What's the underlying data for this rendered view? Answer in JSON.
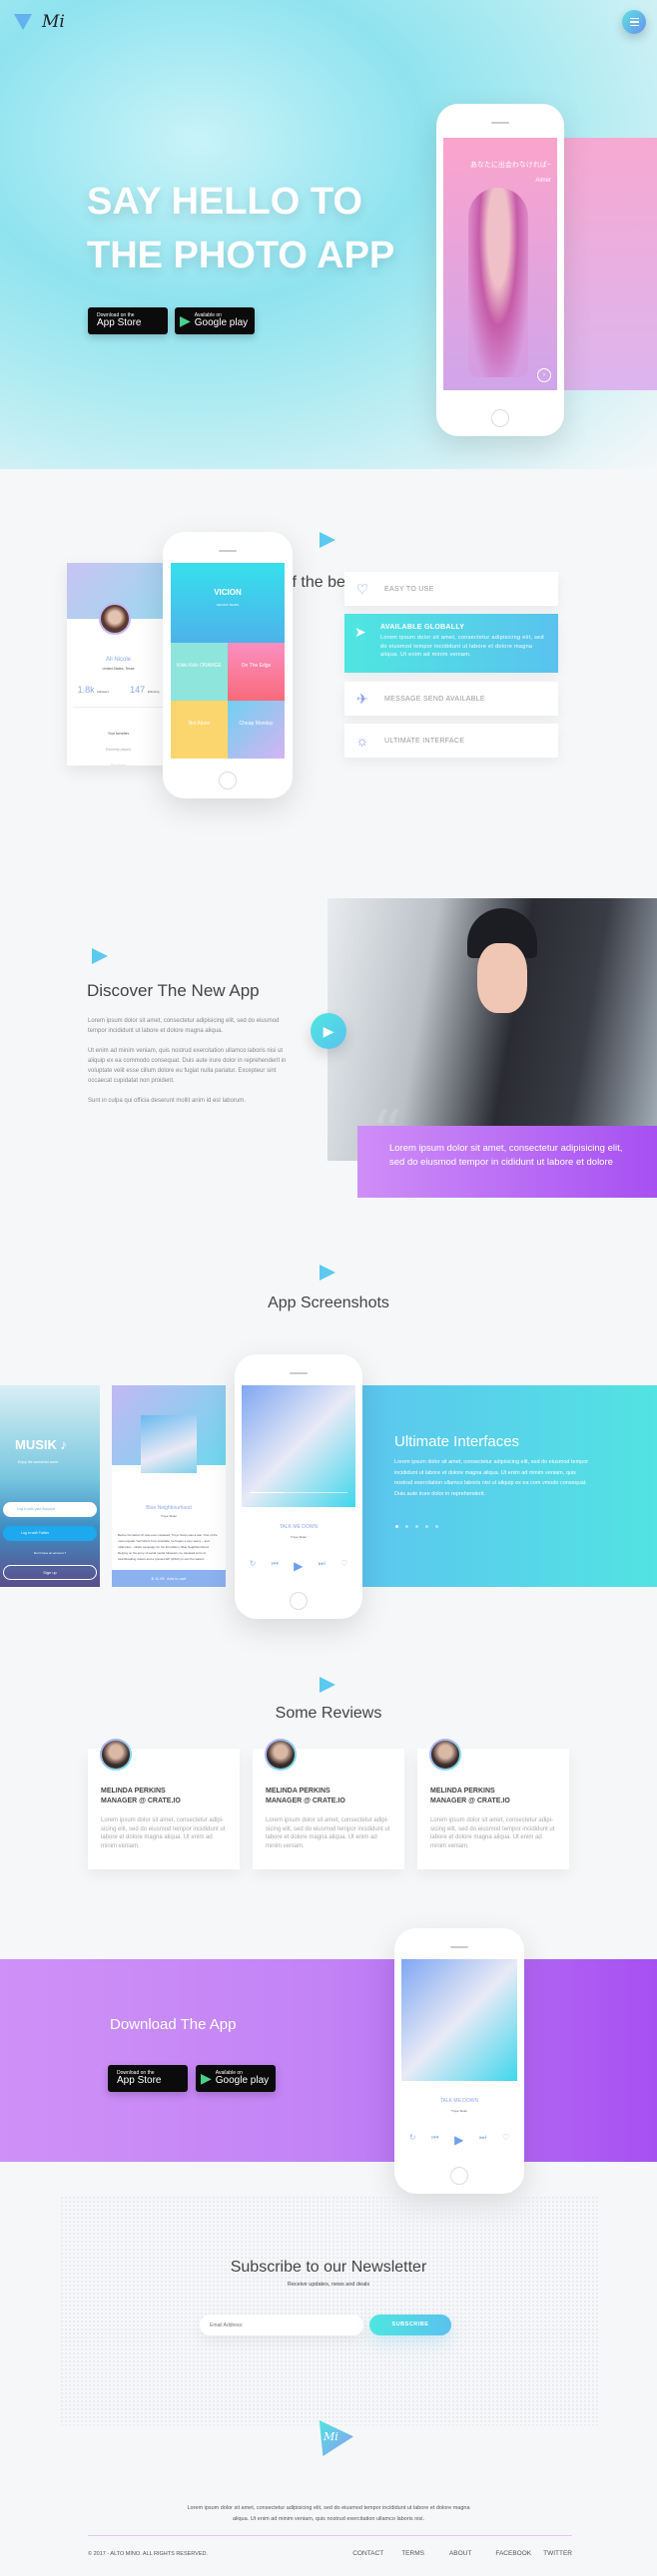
{
  "brand": {
    "logo_text": "Mi"
  },
  "hero": {
    "headline_line1": "SAY HELLO TO",
    "headline_line2": "THE PHOTO APP",
    "app_store": {
      "small": "Download on the",
      "big": "App Store"
    },
    "google_play": {
      "small": "Available on",
      "big": "Google play"
    },
    "phone": {
      "lyric": "あなたに出会わなければ~",
      "artist": "Aimer"
    }
  },
  "features": {
    "title": "Some of the best features",
    "profile": {
      "name": "Ali Nicole",
      "location": "United States, Texas",
      "followers": "1.8k",
      "followers_label": "followers",
      "following": "147",
      "following_label": "following",
      "menu": [
        "Your favorites",
        "Recently played",
        "Purchase"
      ]
    },
    "phone": {
      "banner_title": "VICION",
      "banner_sub": "DEVIN'S TEARS",
      "tiles": [
        "Kikki Kids ORANGE",
        "On The Edge",
        "Not Alone",
        "Cheap Monday"
      ]
    },
    "items": [
      {
        "label": "EASY TO USE",
        "icon": "heart-icon"
      },
      {
        "label": "AVAILABLE GLOBALLY",
        "icon": "navigation-icon",
        "text": "Lorem ipsum dolor sit amet, consectetur adipisicing elit, sed do eiusmod tempor incididunt ut labore et dolore magna aliqua. Ut enim ad minim veniam."
      },
      {
        "label": "MESSAGE SEND AVAILABLE",
        "icon": "paper-plane-icon"
      },
      {
        "label": "ULTIMATE INTERFACE",
        "icon": "lightbulb-icon"
      }
    ]
  },
  "discover": {
    "title": "Discover The New App",
    "p1": "Lorem ipsum dolor sit amet, consectetur adipisicing elit, sed do eiusmod tempor incididunt ut labore et dolore magna aliqua.",
    "p2": "Ut enim ad minim veniam, quis nostrud exercitation ullamco laboris nisi ut aliquip ex ea commodo consequat. Duis aute irure dolor in reprehenderit in voluptate velit esse cillum dolore eu fugiat nulla pariatur. Excepteur sint occaecat cupidatat non proident.",
    "p3": "Sunt in culpa qui officia deserunt mollit anim id est laborum.",
    "quote": "Lorem ipsum dolor sit amet, consectetur adipisicing elit, sed do eiusmod tempor in cididunt ut labore et dolore"
  },
  "screenshots": {
    "title": "App Screenshots",
    "login": {
      "app": "MUSIK ♪",
      "tagline": "Enjoy the wonderful world",
      "login_account": "Log in with your Account",
      "login_twitter": "Log in with Twitter",
      "no_account": "Don't have an account ?",
      "signup": "Sign up"
    },
    "album": {
      "title": "Blue Neighbourhood",
      "artist": "Troye Sivan",
      "text": "Before his debut LP was even released, Troye Sivan was a star. One of the most popular YouTubers from Australia, he began a very savvy – and millennial – rollout campaign for his first album, Blue Neighbourhood. Relying on his army of social media followers, he released a trio of heartbreaking videos and a preview EP (WILD) to test the waters.",
      "price": "$ 11.99",
      "cart": "Add to cart"
    },
    "player": {
      "song": "TALK ME DOWN",
      "artist": "Troye Sivan",
      "time_start": "01:45",
      "time_end": "03:37",
      "progress": 0.35
    },
    "panel": {
      "title": "Ultimate Interfaces",
      "text": "Lorem ipsum dolor sit amet, consectetur adipisicing elit, sed do eiusmod tempor incididunt ut labore et dolore magna aliqua. Ut enim ad minim veniam, quis nostrud exercitation ullamco laboris nisi ut aliquip ex ea com vmodo consequat. Duis aute irure dolor in reprehenderit.",
      "slides": 5,
      "active_slide": 1
    }
  },
  "reviews": {
    "title": "Some Reviews",
    "items": [
      {
        "name": "MELINDA PERKINS",
        "role": "MANAGER @ CRATE.IO",
        "text": "Lorem ipsum dolor sit amet, consectetur adipi-sicing elit, sed do eiusmod tempor incididunt ut labore et dolore magna aliqua. Ut enim ad minim veniam."
      },
      {
        "name": "MELINDA PERKINS",
        "role": "MANAGER @ CRATE.IO",
        "text": "Lorem ipsum dolor sit amet, consectetur adipi-sicing elit, sed do eiusmod tempor incididunt ut labore et dolore magna aliqua. Ut enim ad minim veniam."
      },
      {
        "name": "MELINDA PERKINS",
        "role": "MANAGER @ CRATE.IO",
        "text": "Lorem ipsum dolor sit amet, consectetur adipi-sicing elit, sed do eiusmod tempor incididunt ut labore et dolore magna aliqua. Ut enim ad minim veniam."
      }
    ]
  },
  "download": {
    "title": "Download The App"
  },
  "newsletter": {
    "title": "Subscribe to our Newsletter",
    "subtitle": "Receive updates, news and deals",
    "placeholder": "Email Address:",
    "button": "SUBSCRIBE"
  },
  "footer": {
    "text": "Lorem ipsum dolor sit amet, consectetur adipisicing elit, sed do eiusmod tempor incididunt ut labore et dolore magna aliqua. Ut enim ad minim veniam, quis nostrud exercitation ullamco laboris nisi.",
    "copyright": "© 2017 - ALTO MINO. ALL RIGHTS RESERVED.",
    "links": [
      "CONTACT",
      "TERMS",
      "ABOUT",
      "FACEBOOK",
      "TWITTER"
    ]
  },
  "colors": {
    "teal": "#4fe6e0",
    "blue": "#5ac2ee",
    "purple": "#b76ef5",
    "lavender": "#8c9af0"
  }
}
